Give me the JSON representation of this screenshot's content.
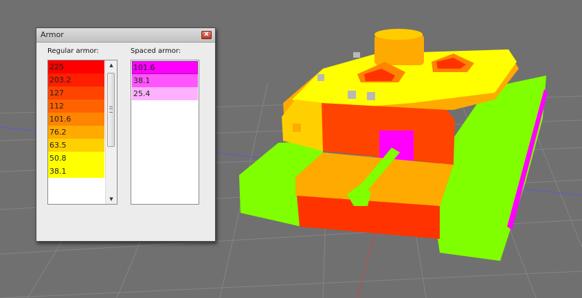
{
  "window": {
    "title": "Armor",
    "close_symbol": "x"
  },
  "regular": {
    "label": "Regular armor:",
    "rows": [
      {
        "value": "225",
        "color": "#ff0000"
      },
      {
        "value": "203.2",
        "color": "#ff1e00"
      },
      {
        "value": "127",
        "color": "#ff4400"
      },
      {
        "value": "112",
        "color": "#ff6300"
      },
      {
        "value": "101.6",
        "color": "#ff8400"
      },
      {
        "value": "76.2",
        "color": "#ffaa00"
      },
      {
        "value": "63.5",
        "color": "#ffd000"
      },
      {
        "value": "50.8",
        "color": "#ffff00"
      },
      {
        "value": "38.1",
        "color": "#ffff00"
      }
    ],
    "scroll_up_glyph": "▲",
    "scroll_down_glyph": "▼"
  },
  "spaced": {
    "label": "Spaced armor:",
    "rows": [
      {
        "value": "101.6",
        "color": "#ff00ff"
      },
      {
        "value": "38.1",
        "color": "#ff55ff"
      },
      {
        "value": "25.4",
        "color": "#ffb0ff"
      }
    ]
  },
  "scene": {
    "background": "#6e6e6e",
    "track_color": "#80ff00",
    "hull_color": "#ffaa00",
    "turret_color": "#ffff00",
    "mantlet_color": "#ff4400",
    "spaced_color": "#ff00ff"
  }
}
